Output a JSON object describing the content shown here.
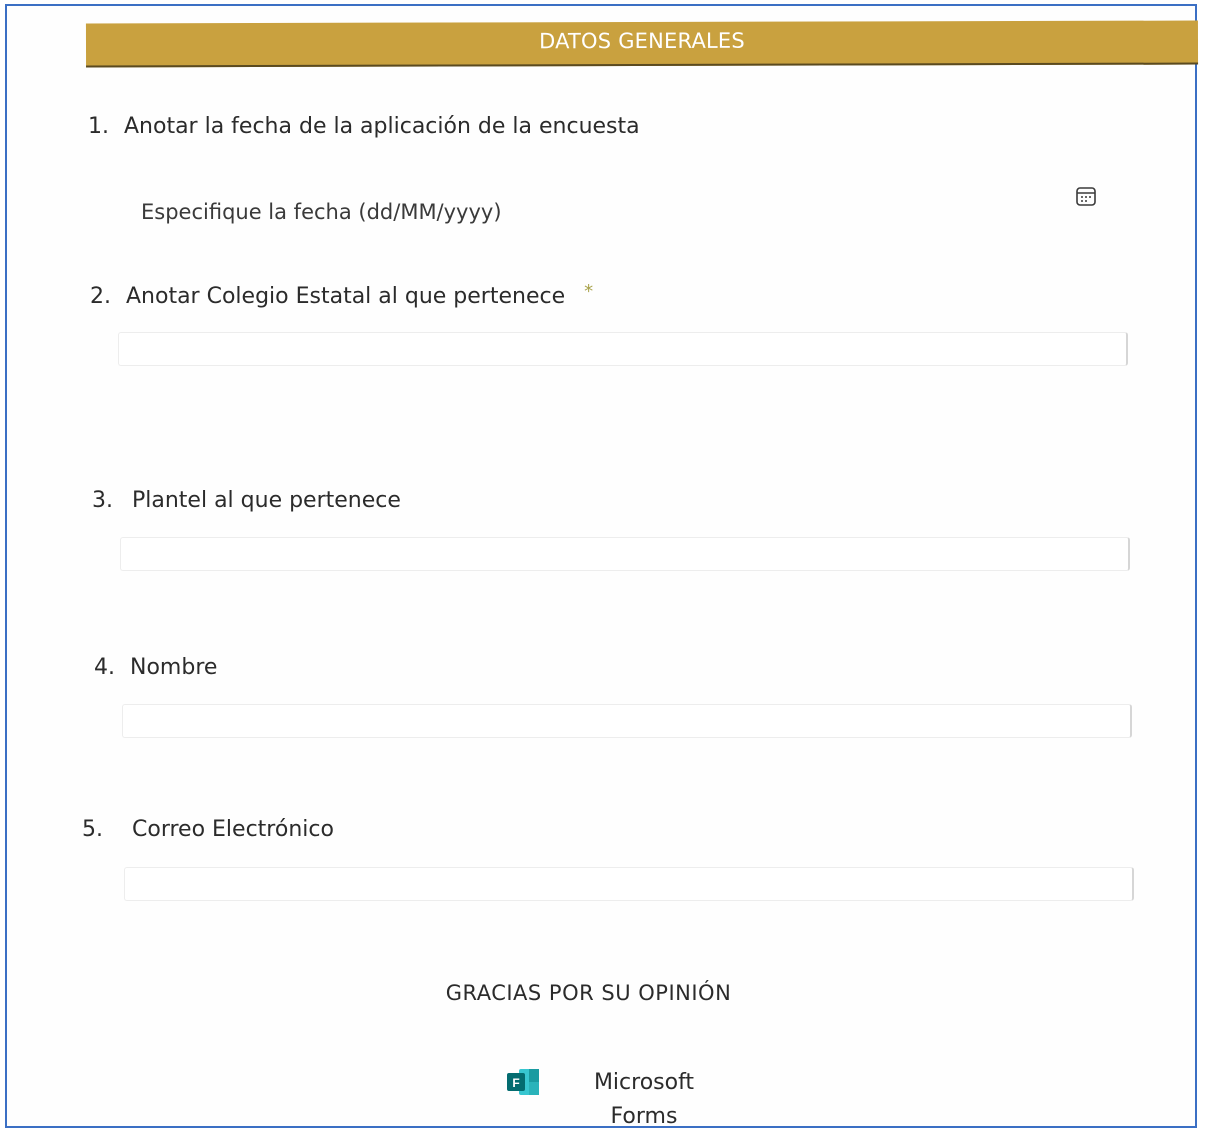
{
  "section": {
    "title": "DATOS GENERALES",
    "header_color": "#c9a13f"
  },
  "questions": [
    {
      "number": "1.",
      "label": "Anotar la fecha de la aplicación de la encuesta"
    },
    {
      "number": "2.",
      "label": "Anotar Colegio Estatal al que pertenece",
      "required_mark": "*"
    },
    {
      "number": "3.",
      "label": "Plantel al que pertenece"
    },
    {
      "number": "4.",
      "label": "Nombre"
    },
    {
      "number": "5.",
      "label": "Correo Electrónico"
    }
  ],
  "date_field": {
    "placeholder": "Especifique la fecha (dd/MM/yyyy)",
    "icon": "calendar-icon"
  },
  "footer": {
    "thanks": "GRACIAS POR SU OPINIÓN",
    "brand_line1": "Microsoft",
    "brand_line2": "Forms",
    "brand_icon": "microsoft-forms-logo",
    "brand_color": "#036c70"
  },
  "colors": {
    "frame_border": "#3b6fc4",
    "required_star": "#a8a24a"
  }
}
